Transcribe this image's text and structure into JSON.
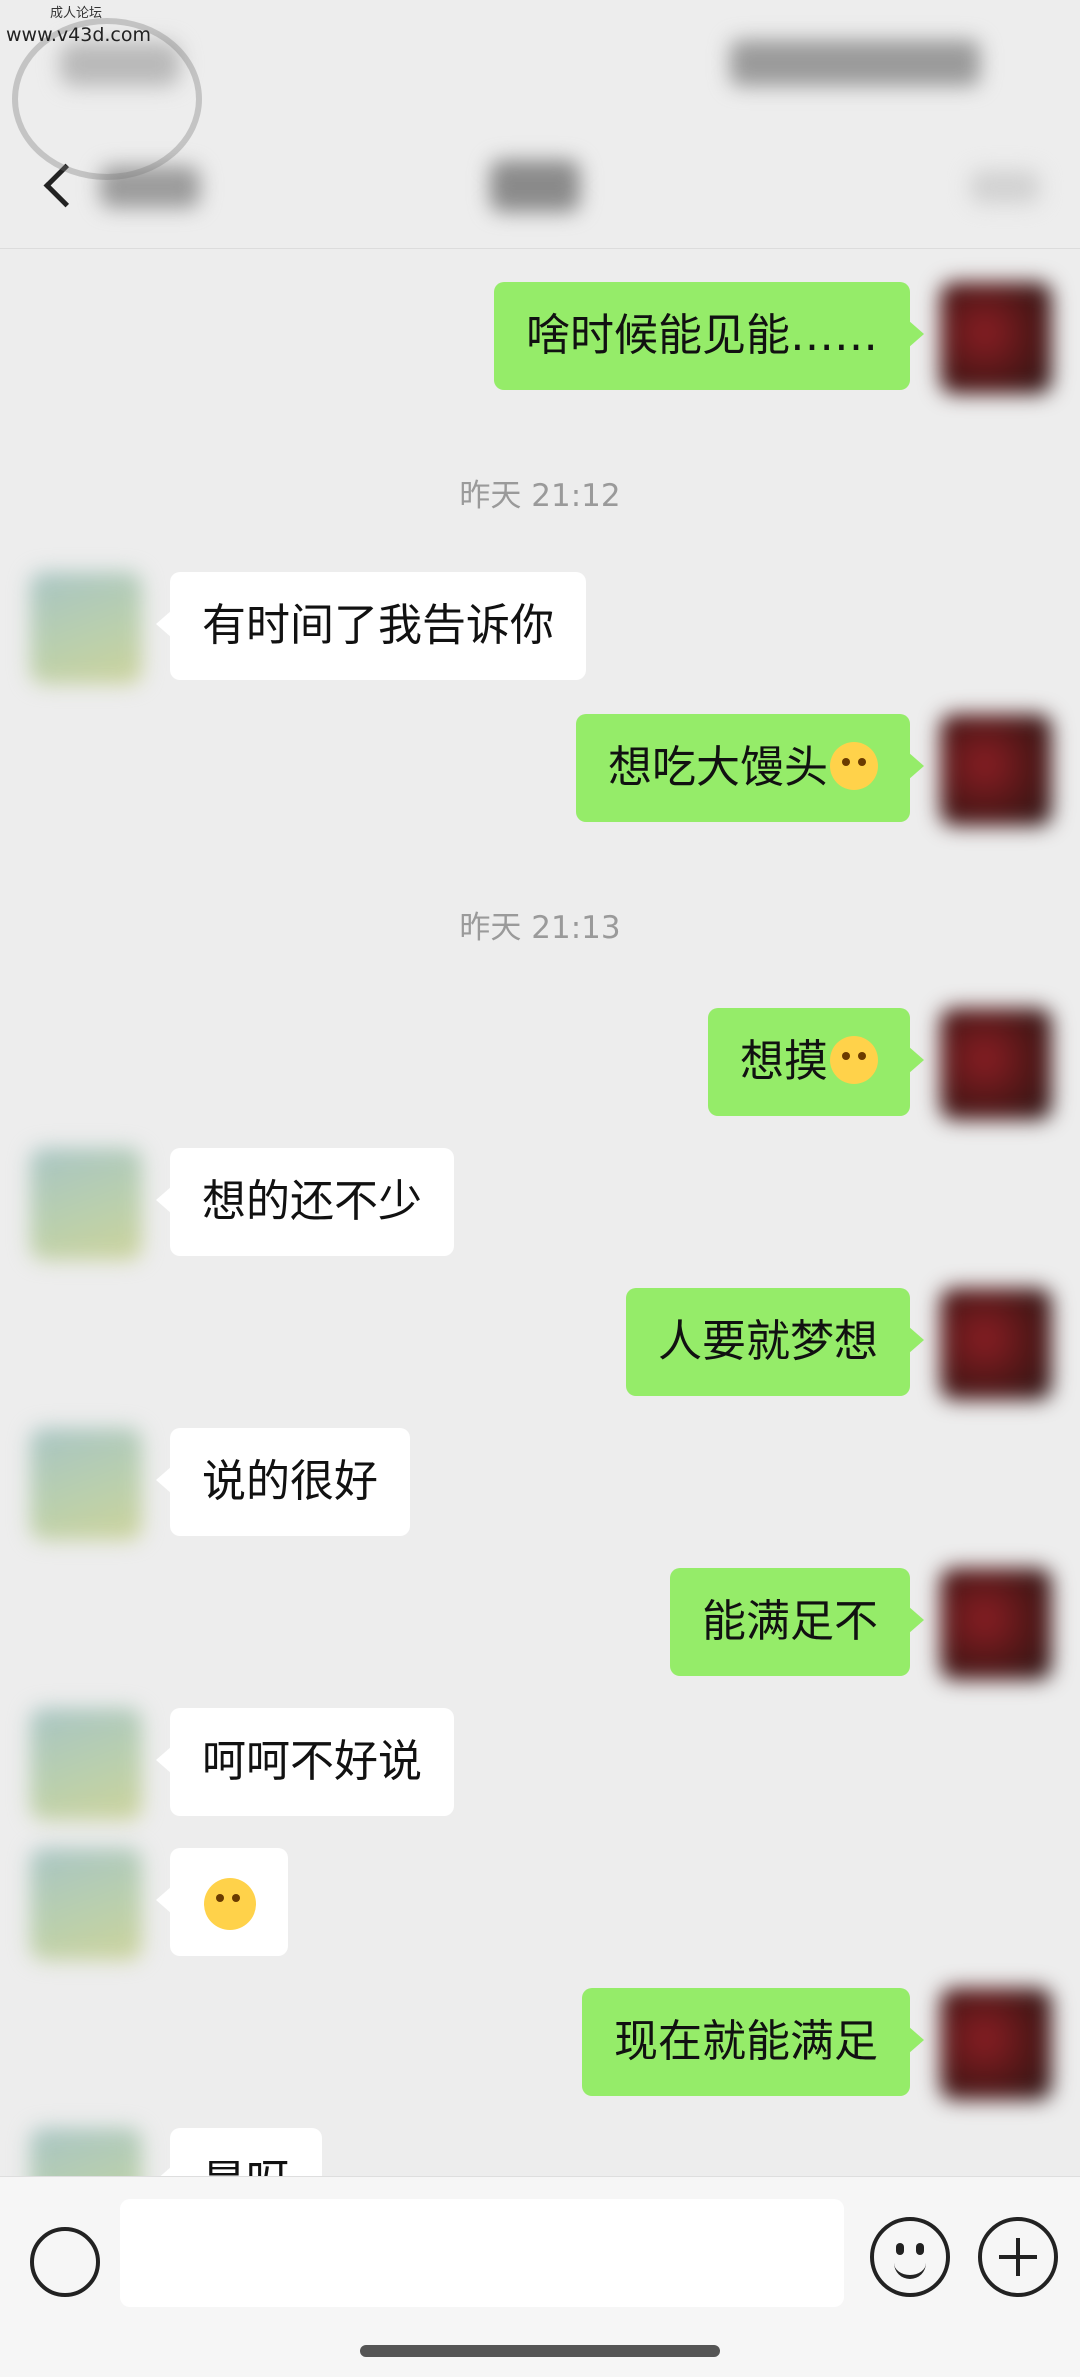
{
  "watermark": {
    "line1": "成人论坛",
    "line2": "www.v43d.com"
  },
  "messages": [
    {
      "text": "啥时候能见能……"
    },
    {
      "time": "昨天 21:12"
    },
    {
      "text": "有时间了我告诉你"
    },
    {
      "text": "想吃大馒头",
      "emoji": "dizzy-face-emoji"
    },
    {
      "time": "昨天 21:13"
    },
    {
      "text": "想摸",
      "emoji": "embarrassed-face-emoji"
    },
    {
      "text": "想的还不少"
    },
    {
      "text": "人要就梦想"
    },
    {
      "text": "说的很好"
    },
    {
      "text": "能满足不"
    },
    {
      "text": "呵呵不好说"
    },
    {
      "emoji": "winking-tongue-face-emoji"
    },
    {
      "text": "现在就能满足"
    },
    {
      "text": "是呀"
    }
  ],
  "icons": {
    "back": "chevron-left-icon",
    "voice": "voice-icon",
    "emoji": "smiley-icon",
    "plus": "plus-icon"
  },
  "colors": {
    "outgoing_bubble": "#95ec69",
    "incoming_bubble": "#ffffff",
    "background": "#ededed"
  }
}
